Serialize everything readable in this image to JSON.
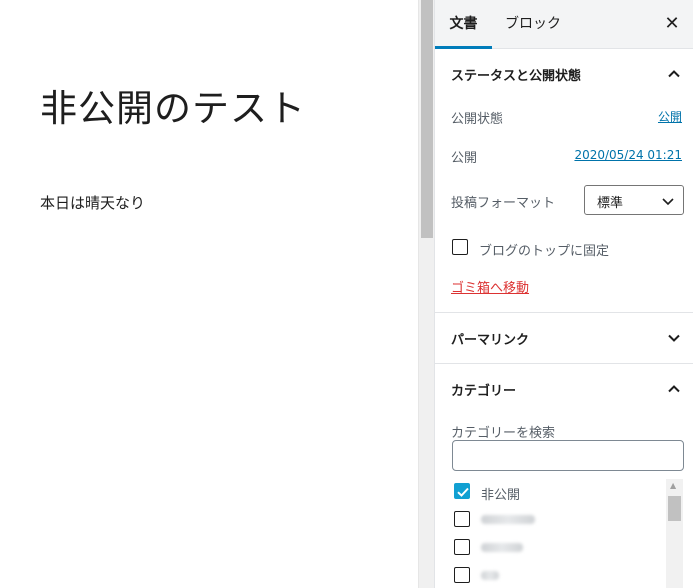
{
  "editor": {
    "post_title": "非公開のテスト",
    "paragraph": "本日は晴天なり"
  },
  "sidebar": {
    "tabs": [
      {
        "label": "文書",
        "active": true
      },
      {
        "label": "ブロック",
        "active": false
      }
    ],
    "close_icon": "close-icon",
    "status_panel": {
      "title": "ステータスと公開状態",
      "expanded": true,
      "visibility_label": "公開状態",
      "visibility_value": "公開",
      "publish_label": "公開",
      "publish_value": "2020/05/24 01:21",
      "format_label": "投稿フォーマット",
      "format_value": "標準",
      "sticky_label": "ブログのトップに固定",
      "sticky_checked": false,
      "trash_label": "ゴミ箱へ移動"
    },
    "permalink_panel": {
      "title": "パーマリンク",
      "expanded": false
    },
    "category_panel": {
      "title": "カテゴリー",
      "expanded": true,
      "search_label": "カテゴリーを検索",
      "search_value": "",
      "items": [
        {
          "label": "非公開",
          "checked": true
        },
        {
          "label": "",
          "checked": false,
          "obscured": true
        },
        {
          "label": "",
          "checked": false,
          "obscured": true
        },
        {
          "label": "",
          "checked": false,
          "obscured": true
        }
      ]
    }
  },
  "colors": {
    "accent": "#007cba",
    "link": "#0073aa",
    "danger": "#dc3232",
    "checkbox_checked": "#11a0d2"
  }
}
